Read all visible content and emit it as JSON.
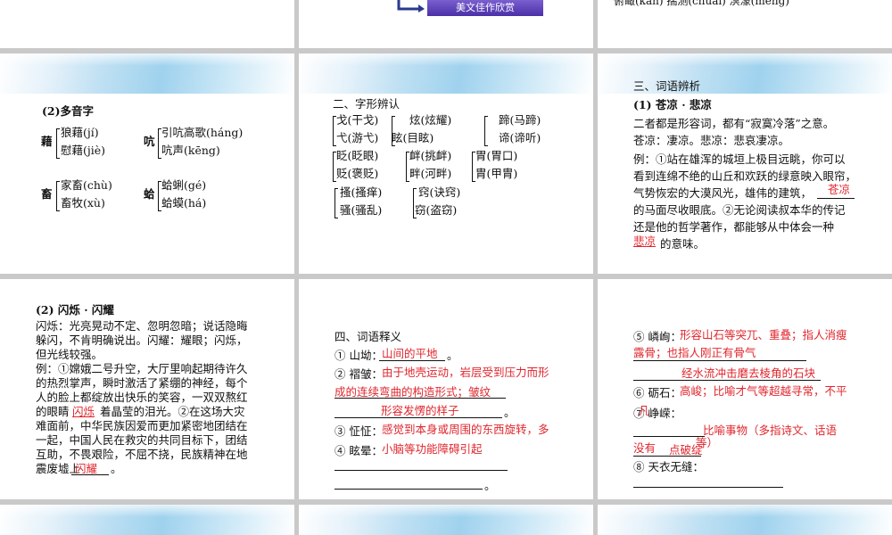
{
  "row1": {
    "s2_button": "美文佳作欣赏",
    "s3_words": "俯瞰(kàn)   揣测(chuǎi)   溟濛(méng)"
  },
  "slide_polyphone": {
    "title": "(2)多音字",
    "g1_char": "藉",
    "g1_a": "狼藉(jí)",
    "g1_b": "慰藉(jiè)",
    "g2_char": "吭",
    "g2_a": "引吭高歌(háng)",
    "g2_b": "吭声(kēng)",
    "g3_char": "畜",
    "g3_a": "家畜(chù)",
    "g3_b": "畜牧(xù)",
    "g4_char": "蛤",
    "g4_a": "蛤蜊(gé)",
    "g4_b": "蛤蟆(há)"
  },
  "slide_glyph": {
    "title": "二、字形辨认",
    "c1": [
      "戈(干戈)",
      "弋(游弋)"
    ],
    "c2": [
      "炫(炫耀)",
      "眩(目眩)"
    ],
    "c3": [
      "蹄(马蹄)",
      "谛(谛听)"
    ],
    "c4": [
      "眨(眨眼)",
      "贬(褒贬)"
    ],
    "c5": [
      "衅(挑衅)",
      "畔(河畔)"
    ],
    "c6": [
      "胃(胃口)",
      "胄(甲胄)"
    ],
    "c7": [
      "搔(搔痒)",
      "骚(骚乱)"
    ],
    "c8": [
      "窍(诀窍)",
      "窃(盗窃)"
    ]
  },
  "slide_analysis": {
    "title": "三、词语辨析",
    "sub": "(1) 苍凉 · 悲凉",
    "p1": "二者都是形容词，都有“寂寞冷落”之意。",
    "p2": "苍凉：凄凉。悲凉：悲哀凄凉。",
    "p3": "例：①站在雄浑的城垣上极目远眺，你可以",
    "p4": "看到连绵不绝的山丘和欢跃的绿意映入眼帘，",
    "p5a": "气势恢宏的大漠风光，雄伟的建筑，",
    "ans1": "苍凉",
    "p6": "的马面尽收眼底。②无论阅读叔本华的传记",
    "p7": "还是他的哲学著作，都能够从中体会一种",
    "ans2": "悲凉",
    "p8": "的意味。"
  },
  "slide_flash": {
    "sub": "(2) 闪烁 · 闪耀",
    "lines": [
      "闪烁：光亮晃动不定、忽明忽暗；说话隐晦",
      "躲闪，不肯明确说出。闪耀：耀眼；闪烁，",
      "但光线较强。",
      "例：①嫦娥二号升空，大厅里响起期待许久",
      "的热烈掌声，瞬时激活了紧绷的神经，每个",
      "人的脸上都绽放出快乐的笑容，一双双熬红"
    ],
    "l7a": "的眼睛",
    "ans1": "闪烁",
    "l7b": "着晶莹的泪光。②在这场大灾",
    "l8": "难面前，中华民族因爱而更加紧密地团结在",
    "l9": "一起，中国人民在救灾的共同目标下，团结",
    "l10": "互助，不畏艰险，不屈不挠，民族精神在地",
    "l11a": "震废墟上",
    "ans2": "闪耀",
    "l11b": "。"
  },
  "slide_define": {
    "title": "四、词语释义",
    "i1": "① 山坳：",
    "i1_ans": "山间的平地",
    "i1_end": "。",
    "i2": "② 褶皱：",
    "i2_ans_a": "由于地壳运动，岩层受到压力而形",
    "i2_ans_b": "成的连续弯曲的构造形式；皱纹",
    "i2_ans_c": "形容发愣的样子",
    "i2_end": "。",
    "i3": "③ 怔怔：",
    "i3_ans": "感觉到本身或周围的东西旋转，多",
    "i4": "④ 眩晕：",
    "i4_ans": "小脑等功能障碍引起",
    "end": "。"
  },
  "slide_define2": {
    "i5": "⑤ 嶙峋：",
    "i5_ans_a": "形容山石等突兀、重叠；指人消瘦",
    "i5_ans_b": "露骨；也指人刚正有骨气",
    "i5_ans_c": "经水流冲击磨去棱角的石块",
    "i6": "⑥ 砺石：",
    "i6_ans": "高峻；比喻才气等超越寻常，不平",
    "i6_ans_b": "凡",
    "i7": "⑦ 峥嵘：",
    "i7_ans_a": "比喻事物（多指诗文、话语",
    "i7_ans_b": "没有",
    "i7_ans_c": "点破绽",
    "i7_ans_d": "等）",
    "i8": "⑧ 天衣无缝："
  }
}
